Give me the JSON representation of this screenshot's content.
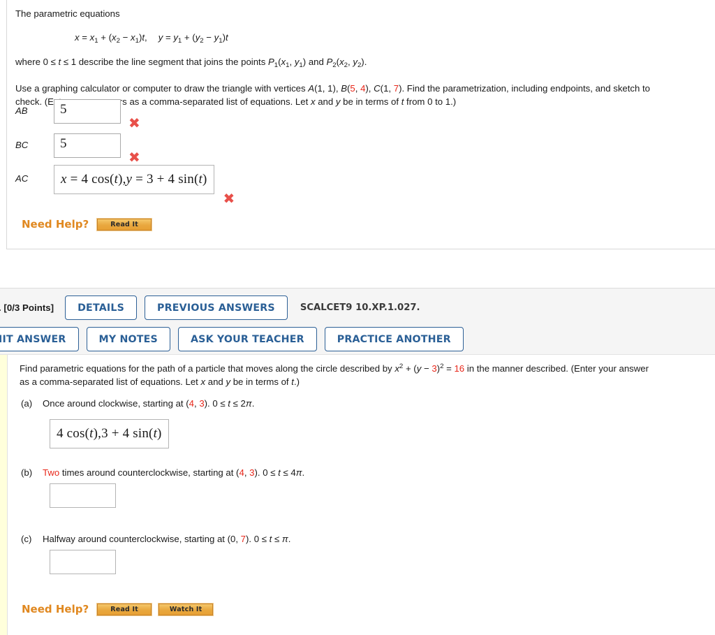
{
  "question1": {
    "intro": "The parametric equations",
    "equation": {
      "x_part": "x = x1 + (x2 − x1)t,",
      "y_part": "y = y1 + (y2 − y1)t"
    },
    "where_text_1": "where 0 ≤ ",
    "where_text_2": " ≤ 1 describe the line segment that joins the points ",
    "where_p1": "P1(x1, y1)",
    "where_and": " and ",
    "where_p2": "P2(x2, y2).",
    "instruction_line1_a": "Use a graphing calculator or computer to draw the triangle with vertices ",
    "vertex_a": "A(1, 1)",
    "vertex_b_pre": "B(",
    "vertex_b_v1": "5",
    "vertex_b_mid": ", ",
    "vertex_b_v2": "4",
    "vertex_b_post": ")",
    "vertex_c_pre": "C(1, ",
    "vertex_c_v1": "7",
    "vertex_c_post": ")",
    "instruction_line1_b": ". Find the parametrization, including endpoints, and sketch to",
    "instruction_line2": "check. (Enter your answers as a comma-separated list of equations. Let x and y be in terms of t from 0 to 1.)",
    "rows": [
      {
        "label": "AB",
        "value": "5",
        "status": "incorrect",
        "status_glyph": "✖"
      },
      {
        "label": "BC",
        "value": "5",
        "status": "incorrect",
        "status_glyph": "✖"
      },
      {
        "label": "AC",
        "value": "x = 4 cos(t),y = 3 + 4 sin(t)",
        "status": "incorrect",
        "status_glyph": "✖"
      }
    ],
    "need_help": {
      "label": "Need Help?",
      "buttons": [
        {
          "label": "Read It"
        }
      ]
    }
  },
  "question2": {
    "header": {
      "number_fragment": ".",
      "points": "[0/3 Points]",
      "buttons_row1": [
        {
          "label": "DETAILS"
        },
        {
          "label": "PREVIOUS ANSWERS"
        }
      ],
      "source_label": "SCALCET9 10.XP.1.027.",
      "buttons_row2": [
        {
          "label": "SUBMIT ANSWER"
        },
        {
          "label": "MY NOTES"
        },
        {
          "label": "ASK YOUR TEACHER"
        },
        {
          "label": "PRACTICE ANOTHER"
        }
      ]
    },
    "body": {
      "prompt_a": "Find parametric equations for the path of a particle that moves along the circle described by ",
      "circle_x2": "x",
      "circle_mid": " + (y − ",
      "circle_h": "3",
      "circle_close": ")",
      "circle_eq": " = ",
      "circle_r2": "16",
      "prompt_b": " in the manner described. (Enter your answer",
      "prompt_c": "as a comma-separated list of equations. Let x and y be in terms of t.)",
      "parts": [
        {
          "label": "(a)",
          "text_pre": "Once around clockwise, starting at (",
          "val1": "4",
          "text_mid": ", ",
          "val2": "3",
          "text_post": "). 0 ≤ t ≤ 2π.",
          "answer": "4 cos(t),3 + 4 sin(t)",
          "answer_filled": true
        },
        {
          "label": "(b)",
          "highlight": "Two",
          "text_pre": " times around counterclockwise, starting at (",
          "val1": "4",
          "text_mid": ", ",
          "val2": "3",
          "text_post": "). 0 ≤ t ≤ 4π.",
          "answer": "",
          "answer_filled": false
        },
        {
          "label": "(c)",
          "text_pre": "Halfway around counterclockwise, starting at (0, ",
          "val1": "",
          "text_mid": "",
          "val2": "7",
          "text_post": "). 0 ≤ t ≤ π.",
          "answer": "",
          "answer_filled": false
        }
      ],
      "need_help": {
        "label": "Need Help?",
        "buttons": [
          {
            "label": "Read It"
          },
          {
            "label": "Watch It"
          }
        ]
      }
    }
  },
  "colors": {
    "red_value": "#e8271a",
    "orange_help": "#e08820",
    "blue_button": "#2a5f96",
    "incorrect_mark": "#e8504a",
    "yellow_strip": "#ffffdb"
  }
}
